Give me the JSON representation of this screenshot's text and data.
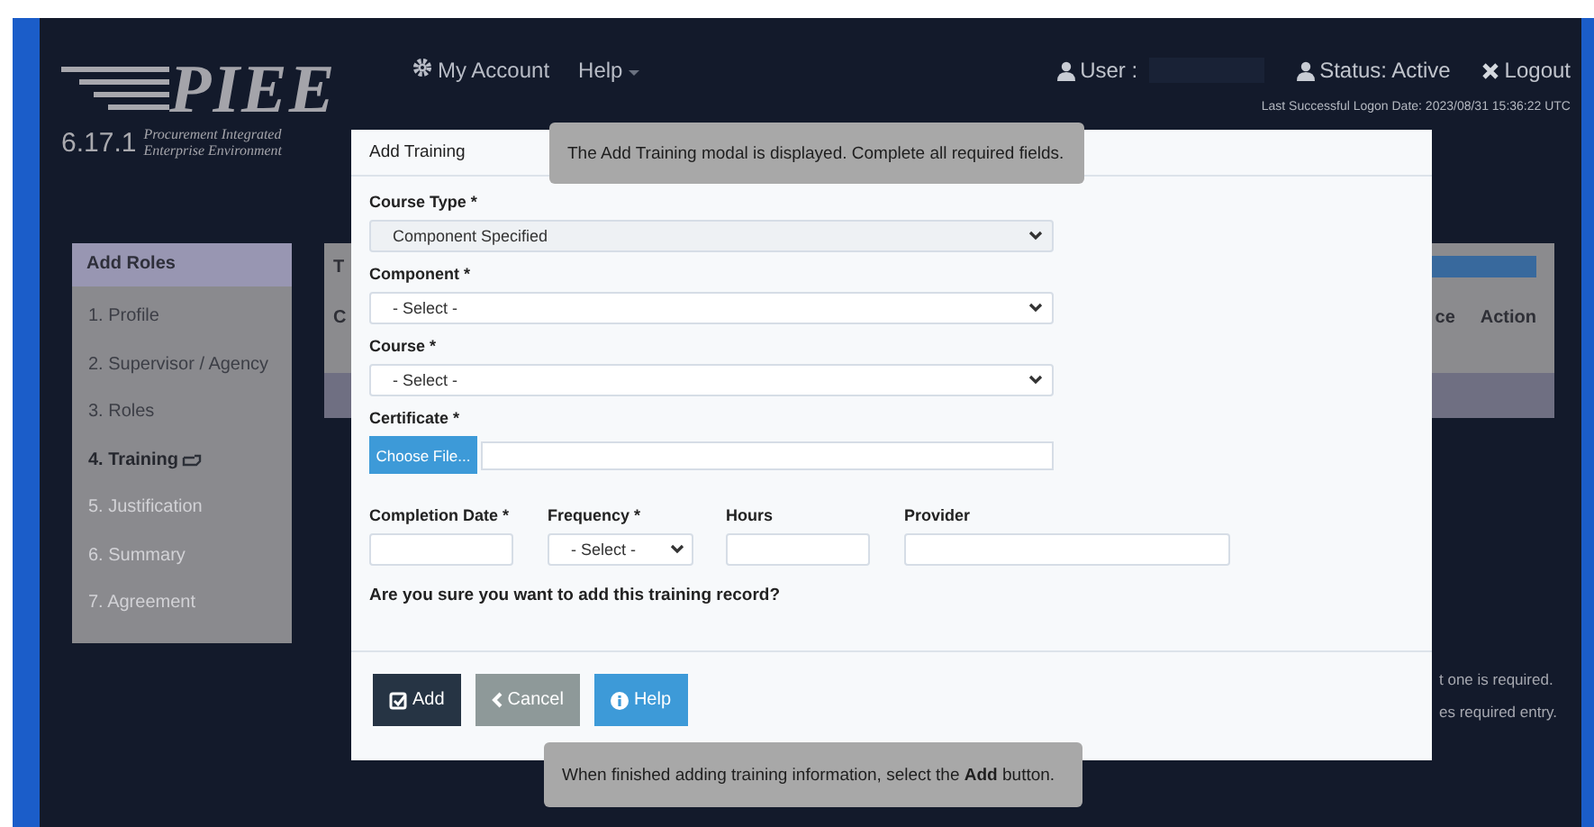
{
  "header": {
    "logo": {
      "name": "PIEE",
      "version": "6.17.1",
      "subtitle_lines": [
        "Procurement Integrated",
        "Enterprise Environment"
      ]
    },
    "nav": [
      {
        "label": "My Account",
        "kind": "gear"
      },
      {
        "label": "Help",
        "kind": "dropdown"
      }
    ],
    "user_label": "User :",
    "status": "Status: Active",
    "logout": "Logout",
    "last_logon": "Last Successful Logon Date: 2023/08/31 15:36:22 UTC"
  },
  "sidebar": {
    "title": "Add Roles",
    "steps": [
      {
        "label": "1. Profile",
        "selected": false,
        "disabled": false
      },
      {
        "label": "2. Supervisor / Agency",
        "selected": false,
        "disabled": false
      },
      {
        "label": "3. Roles",
        "selected": false,
        "disabled": false
      },
      {
        "label": "4. Training",
        "selected": true,
        "disabled": false
      },
      {
        "label": "5. Justification",
        "selected": false,
        "disabled": true
      },
      {
        "label": "6. Summary",
        "selected": false,
        "disabled": true
      },
      {
        "label": "7. Agreement",
        "selected": false,
        "disabled": true
      }
    ]
  },
  "background_panel": {
    "title_fragment": "T",
    "column_fragment": "C",
    "columns_right": [
      "ce",
      "Action"
    ]
  },
  "notes": [
    "t one is required.",
    "es required entry."
  ],
  "modal": {
    "title": "Add Training",
    "fields": [
      {
        "label": "Course Type *",
        "kind": "select",
        "value": "Component Specified"
      },
      {
        "label": "Component *",
        "kind": "select",
        "value": "- Select -"
      },
      {
        "label": "Course *",
        "kind": "select",
        "value": "- Select -"
      },
      {
        "label": "Certificate *",
        "kind": "file",
        "button": "Choose File..."
      }
    ],
    "row_fields": [
      {
        "label": "Completion Date *",
        "kind": "text"
      },
      {
        "label": "Frequency *",
        "kind": "select",
        "value": "- Select -"
      },
      {
        "label": "Hours",
        "kind": "text"
      },
      {
        "label": "Provider",
        "kind": "wide"
      }
    ],
    "question": "Are you sure you want to add this training record?",
    "buttons": [
      {
        "label": "Add",
        "kind": "primary"
      },
      {
        "label": "Cancel",
        "kind": "secondary"
      },
      {
        "label": "Help",
        "kind": "info"
      }
    ]
  },
  "tooltips": [
    {
      "text": "The Add Training modal is displayed. Complete all required fields.",
      "kind": "top"
    },
    {
      "text": "When finished adding training information, select the **Add** button.",
      "kind": "bottom"
    }
  ]
}
